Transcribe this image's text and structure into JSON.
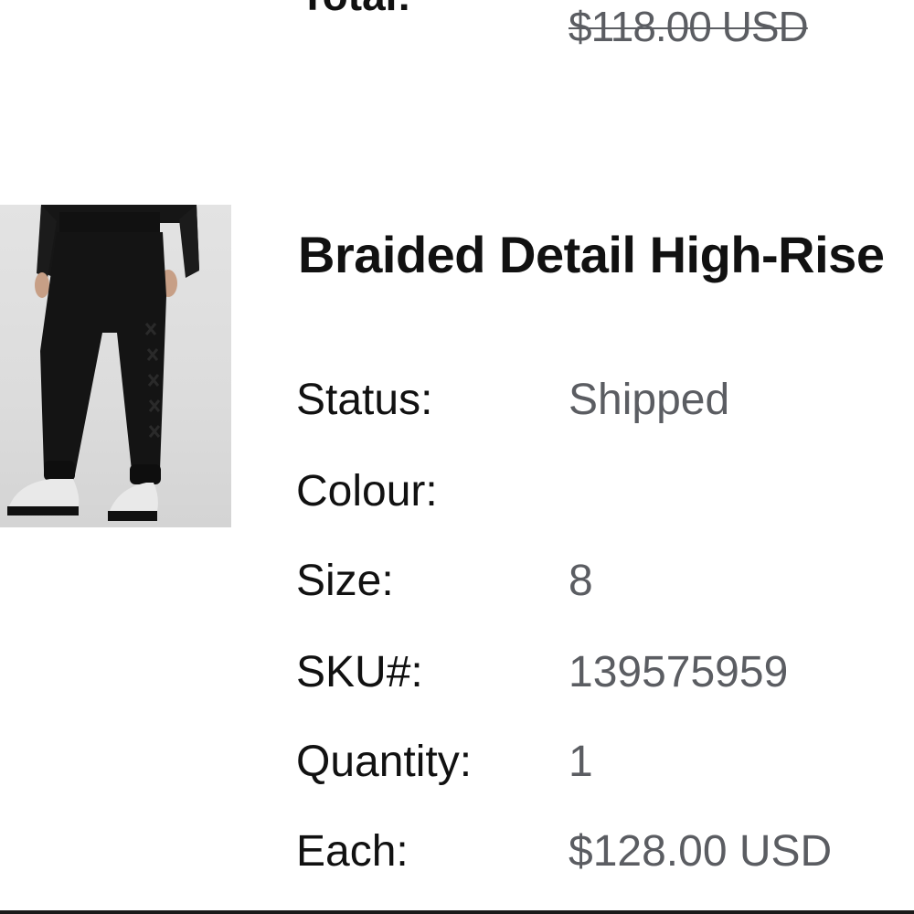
{
  "previous_item": {
    "total_label": "Total:",
    "total_value": "$118.00 USD"
  },
  "item": {
    "title": "Braided Detail High-Rise",
    "image_icon": "product-photo-black-joggers",
    "details": [
      {
        "label": "Status:",
        "value": "Shipped"
      },
      {
        "label": "Colour:",
        "value": ""
      },
      {
        "label": "Size:",
        "value": "8"
      },
      {
        "label": "SKU#:",
        "value": "139575959"
      },
      {
        "label": "Quantity:",
        "value": "1"
      },
      {
        "label": "Each:",
        "value": "$128.00 USD"
      }
    ]
  },
  "colors": {
    "text_primary": "#111111",
    "text_secondary": "#5b5d62",
    "background": "#ffffff"
  }
}
